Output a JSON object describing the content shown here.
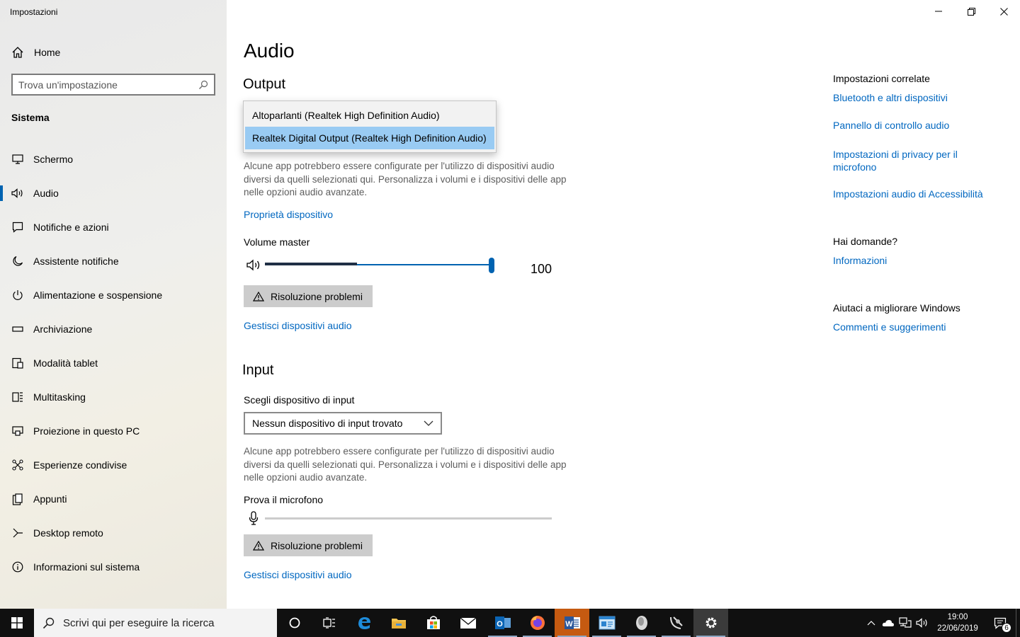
{
  "window": {
    "title": "Impostazioni"
  },
  "sidebar": {
    "home_label": "Home",
    "search_placeholder": "Trova un'impostazione",
    "section": "Sistema",
    "items": [
      {
        "label": "Schermo",
        "icon": "monitor-icon"
      },
      {
        "label": "Audio",
        "icon": "speaker-icon",
        "active": true
      },
      {
        "label": "Notifiche e azioni",
        "icon": "notification-icon"
      },
      {
        "label": "Assistente notifiche",
        "icon": "moon-icon"
      },
      {
        "label": "Alimentazione e sospensione",
        "icon": "power-icon"
      },
      {
        "label": "Archiviazione",
        "icon": "storage-icon"
      },
      {
        "label": "Modalità tablet",
        "icon": "tablet-icon"
      },
      {
        "label": "Multitasking",
        "icon": "multitasking-icon"
      },
      {
        "label": "Proiezione in questo PC",
        "icon": "projection-icon"
      },
      {
        "label": "Esperienze condivise",
        "icon": "shared-icon"
      },
      {
        "label": "Appunti",
        "icon": "clipboard-icon"
      },
      {
        "label": "Desktop remoto",
        "icon": "remote-desktop-icon"
      },
      {
        "label": "Informazioni sul sistema",
        "icon": "info-icon"
      }
    ]
  },
  "main": {
    "title": "Audio",
    "output": {
      "heading": "Output",
      "options": [
        "Altoparlanti (Realtek High Definition Audio)",
        "Realtek Digital Output (Realtek High Definition Audio)"
      ],
      "selected_index": 1,
      "description": "Alcune app potrebbero essere configurate per l'utilizzo di dispositivi audio diversi da quelli selezionati qui. Personalizza i volumi e i dispositivi delle app nelle opzioni audio avanzate.",
      "device_properties_link": "Proprietà dispositivo",
      "volume_label": "Volume master",
      "volume_value": "100",
      "troubleshoot_label": "Risoluzione problemi",
      "manage_link": "Gestisci dispositivi audio"
    },
    "input": {
      "heading": "Input",
      "choose_label": "Scegli dispositivo di input",
      "selected_device": "Nessun dispositivo di input trovato",
      "description": "Alcune app potrebbero essere configurate per l'utilizzo di dispositivi audio diversi da quelli selezionati qui. Personalizza i volumi e i dispositivi delle app nelle opzioni audio avanzate.",
      "test_label": "Prova il microfono",
      "troubleshoot_label": "Risoluzione problemi",
      "manage_link": "Gestisci dispositivi audio"
    }
  },
  "related": {
    "heading": "Impostazioni correlate",
    "links": [
      "Bluetooth e altri dispositivi",
      "Pannello di controllo audio",
      "Impostazioni di privacy per il microfono",
      "Impostazioni audio di Accessibilità"
    ],
    "questions_heading": "Hai domande?",
    "questions_link": "Informazioni",
    "improve_heading": "Aiutaci a migliorare Windows",
    "improve_link": "Commenti e suggerimenti"
  },
  "taskbar": {
    "search_placeholder": "Scrivi qui per eseguire la ricerca",
    "time": "19:00",
    "date": "22/06/2019",
    "notification_count": "6"
  },
  "colors": {
    "accent": "#0063b1",
    "link": "#0067c0",
    "selected_option": "#99cbf3"
  }
}
